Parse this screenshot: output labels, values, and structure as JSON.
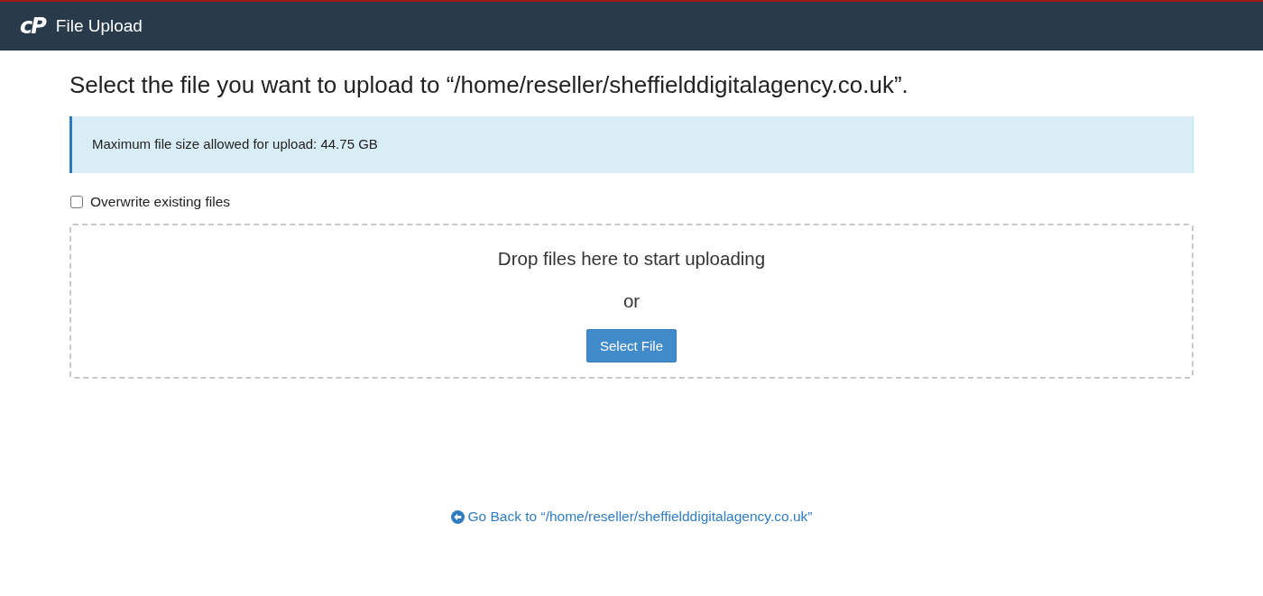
{
  "header": {
    "logo": "cP",
    "title": "File Upload"
  },
  "heading": "Select the file you want to upload to “/home/reseller/sheffielddigitalagency.co.uk”.",
  "info_box": {
    "text": "Maximum file size allowed for upload: 44.75 GB"
  },
  "overwrite_option": {
    "label": "Overwrite existing files",
    "checked": false
  },
  "drop_zone": {
    "prompt": "Drop files here to start uploading",
    "separator": "or",
    "button": "Select File"
  },
  "back_link": {
    "label": "Go Back to “/home/reseller/sheffielddigitalagency.co.uk”"
  }
}
